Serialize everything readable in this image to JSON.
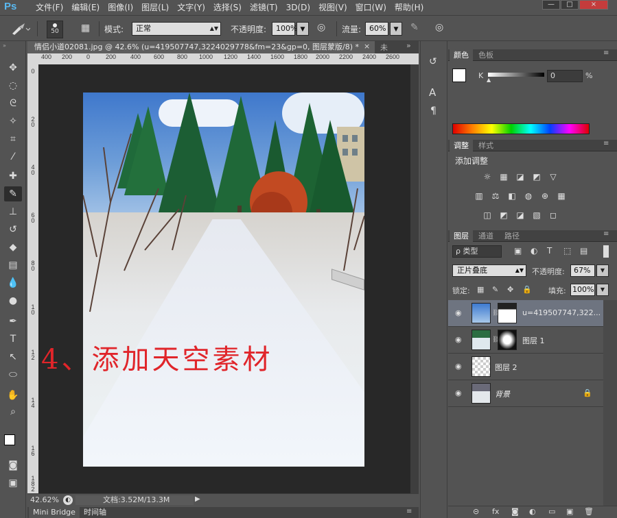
{
  "app": {
    "logo": "Ps"
  },
  "menu": [
    "文件(F)",
    "编辑(E)",
    "图像(I)",
    "图层(L)",
    "文字(Y)",
    "选择(S)",
    "滤镜(T)",
    "3D(D)",
    "视图(V)",
    "窗口(W)",
    "帮助(H)"
  ],
  "window_buttons": [
    "—",
    "□",
    "×"
  ],
  "options": {
    "brush_size": "50",
    "mode_label": "模式:",
    "mode_value": "正常",
    "opacity_label": "不透明度:",
    "opacity_value": "100%",
    "flow_label": "流量:",
    "flow_value": "60%"
  },
  "document": {
    "tab_title": "情侣小道02081.jpg @ 42.6% (u=419507747,3224029778&fm=23&gp=0, 图层蒙版/8) *",
    "tab_close": "×",
    "second_tab": "未",
    "ruler_top": [
      "400",
      "200",
      "0",
      "200",
      "400",
      "600",
      "800",
      "1000",
      "1200",
      "1400",
      "1600",
      "1800",
      "2000",
      "2200",
      "2400",
      "2600"
    ],
    "ruler_left": [
      "0",
      "2",
      "0",
      "4",
      "0",
      "6",
      "0",
      "8",
      "0",
      "1",
      "0",
      "1",
      "2",
      "1",
      "4",
      "1",
      "6",
      "1",
      "8",
      "2"
    ],
    "overlay_text": "4、添加天空素材"
  },
  "status": {
    "zoom": "42.62%",
    "doc_info": "文档:3.52M/13.3M"
  },
  "bottom_tabs": [
    "Mini Bridge",
    "时间轴"
  ],
  "color_panel": {
    "tabs": [
      "颜色",
      "色板"
    ],
    "channel": "K",
    "value": "0",
    "unit": "%"
  },
  "adjust_panel": {
    "tabs": [
      "调整",
      "样式"
    ],
    "title": "添加调整",
    "row1": [
      "☼",
      "▦",
      "◪",
      "◩",
      "▽"
    ],
    "row2": [
      "▥",
      "⚖",
      "◧",
      "◍",
      "⊕",
      "▦"
    ],
    "row3": [
      "◫",
      "◩",
      "◪",
      "▧",
      "◻"
    ]
  },
  "layers_panel": {
    "tabs": [
      "图层",
      "通道",
      "路径"
    ],
    "filter_label": "ρ 类型",
    "blend_mode": "正片叠底",
    "opacity_label": "不透明度:",
    "opacity_value": "67%",
    "lock_label": "锁定:",
    "fill_label": "填充:",
    "fill_value": "100%",
    "layers": [
      {
        "name": "u=419507747,322...",
        "selected": true
      },
      {
        "name": "图层 1",
        "selected": false
      },
      {
        "name": "图层 2",
        "selected": false
      },
      {
        "name": "背景",
        "selected": false
      }
    ],
    "footer_icons": [
      "⊝",
      "fx",
      "◙",
      "◐",
      "▭",
      "▣",
      "🗑"
    ]
  },
  "colors": {
    "accent": "#59b8f0",
    "panel_bg": "#535353",
    "canvas_bg": "#282828",
    "selected_layer": "#6e7480",
    "overlay_text": "#e0252a"
  }
}
